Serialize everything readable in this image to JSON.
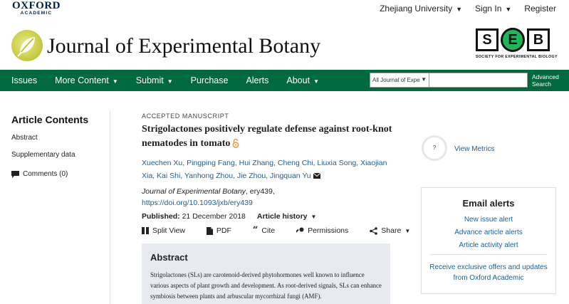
{
  "top": {
    "publisher_line1": "OXFORD",
    "publisher_line2": "ACADEMIC",
    "institution": "Zhejiang University",
    "sign_in": "Sign In",
    "register": "Register"
  },
  "header": {
    "journal_title": "Journal of Experimental Botany",
    "seb_letters": [
      "S",
      "E",
      "B"
    ],
    "seb_caption": "SOCIETY FOR EXPERIMENTAL BIOLOGY"
  },
  "nav": {
    "items": [
      {
        "label": "Issues",
        "dropdown": false
      },
      {
        "label": "More Content",
        "dropdown": true
      },
      {
        "label": "Submit",
        "dropdown": true
      },
      {
        "label": "Purchase",
        "dropdown": false
      },
      {
        "label": "Alerts",
        "dropdown": false
      },
      {
        "label": "About",
        "dropdown": true
      }
    ],
    "search_scope": "All Journal of Expe",
    "search_value": "",
    "advanced_line1": "Advanced",
    "advanced_line2": "Search"
  },
  "sidebar": {
    "heading": "Article Contents",
    "links": [
      "Abstract",
      "Supplementary data"
    ],
    "comments": "Comments (0)"
  },
  "article": {
    "status": "ACCEPTED MANUSCRIPT",
    "title": "Strigolactones positively regulate defense against root-knot nematodes in tomato",
    "authors": [
      "Xuechen Xu,",
      "Pingping Fang,",
      "Hui Zhang,",
      "Cheng Chi,",
      "Liuxia Song,",
      "Xiaojian Xia,",
      "Kai Shi,",
      "Yanhong Zhou,",
      "Jie Zhou,",
      "Jingquan Yu"
    ],
    "journal": "Journal of Experimental Botany",
    "article_id": ", ery439,",
    "doi": "https://doi.org/10.1093/jxb/ery439",
    "published_label": "Published:",
    "published_date": "21 December 2018",
    "history_label": "Article history"
  },
  "toolbar": {
    "split_view": "Split View",
    "pdf": "PDF",
    "cite": "Cite",
    "permissions": "Permissions",
    "share": "Share"
  },
  "abstract": {
    "heading": "Abstract",
    "text": "Strigolactones (SLs) are carotenoid-derived phytohormones well known to influence various aspects of plant growth and development. As root-derived signals, SLs can enhance symbiosis between plants and arbuscular mycorrhizal fungi (AMF)."
  },
  "metrics": {
    "badge": "?",
    "view_metrics": "View Metrics"
  },
  "alerts": {
    "heading": "Email alerts",
    "links": [
      "New issue alert",
      "Advance article alerts",
      "Article activity alert"
    ],
    "offer": "Receive exclusive offers and updates from Oxford Academic"
  },
  "colors": {
    "nav_green": "#00693e",
    "link_blue": "#1b5f9a",
    "abstract_bg": "#e7ebf1",
    "oa_orange": "#f39c3c"
  }
}
